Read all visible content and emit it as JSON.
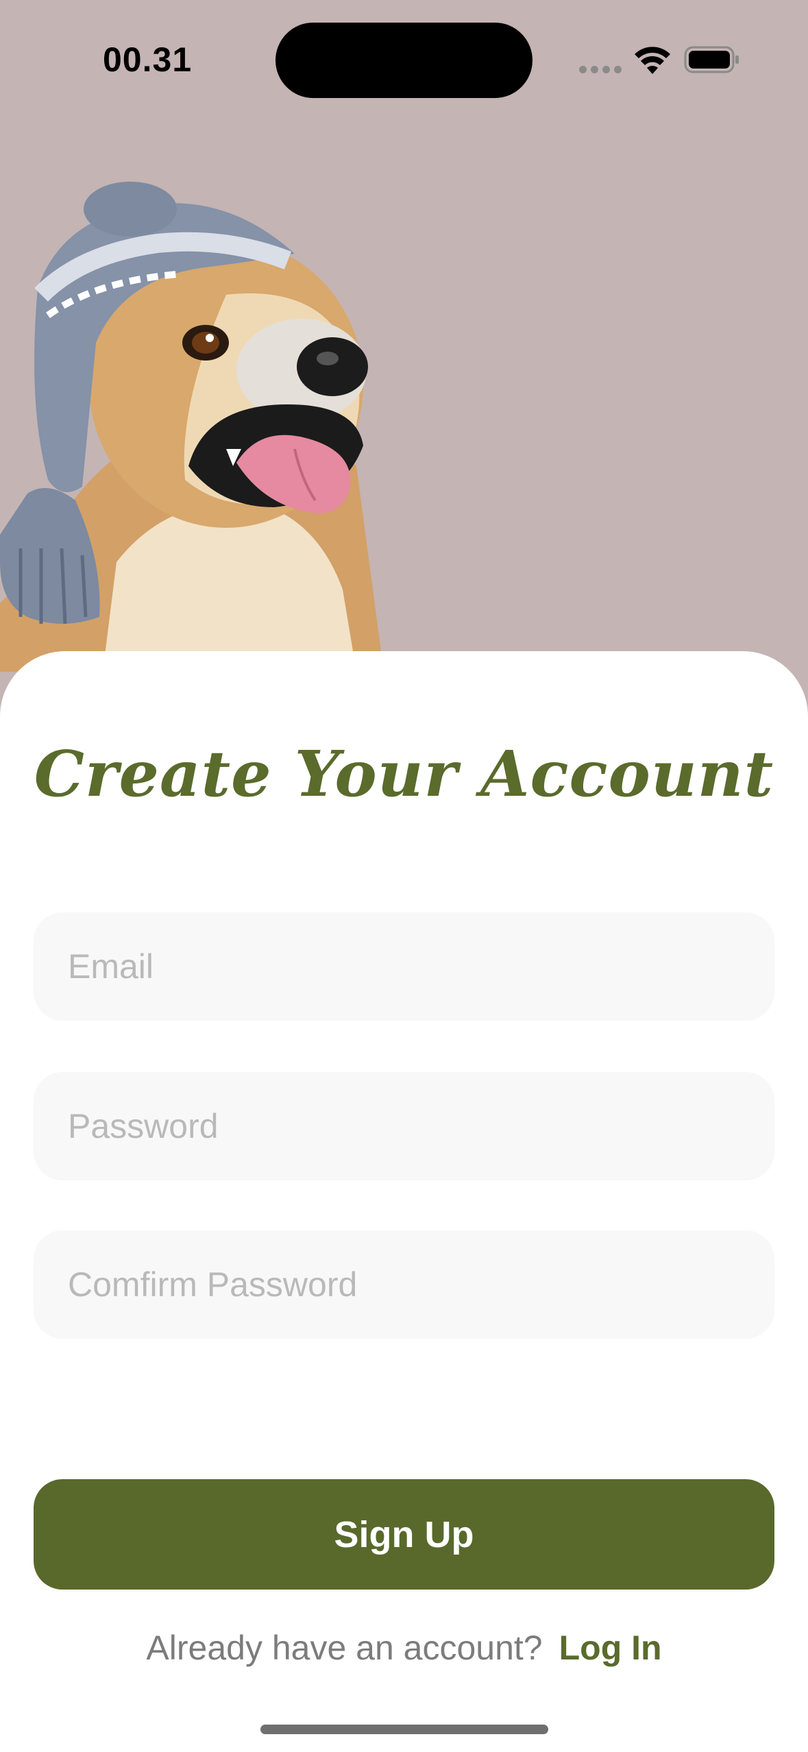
{
  "status_bar": {
    "time": "00.31",
    "icons": [
      "cellular-signal-icon",
      "wifi-icon",
      "battery-icon"
    ]
  },
  "hero": {
    "image": "dog-in-knit-hat-illustration",
    "background_color": "#c4b4b3"
  },
  "form": {
    "title": "Create Your Account",
    "email_placeholder": "Email",
    "password_placeholder": "Password",
    "confirm_password_placeholder": "Comfirm Password",
    "submit_label": "Sign Up"
  },
  "footer": {
    "prompt": "Already have an account?",
    "link_label": "Log In"
  },
  "colors": {
    "accent": "#59692b",
    "sheet": "#ffffff",
    "field_background": "#f8f8f8"
  }
}
